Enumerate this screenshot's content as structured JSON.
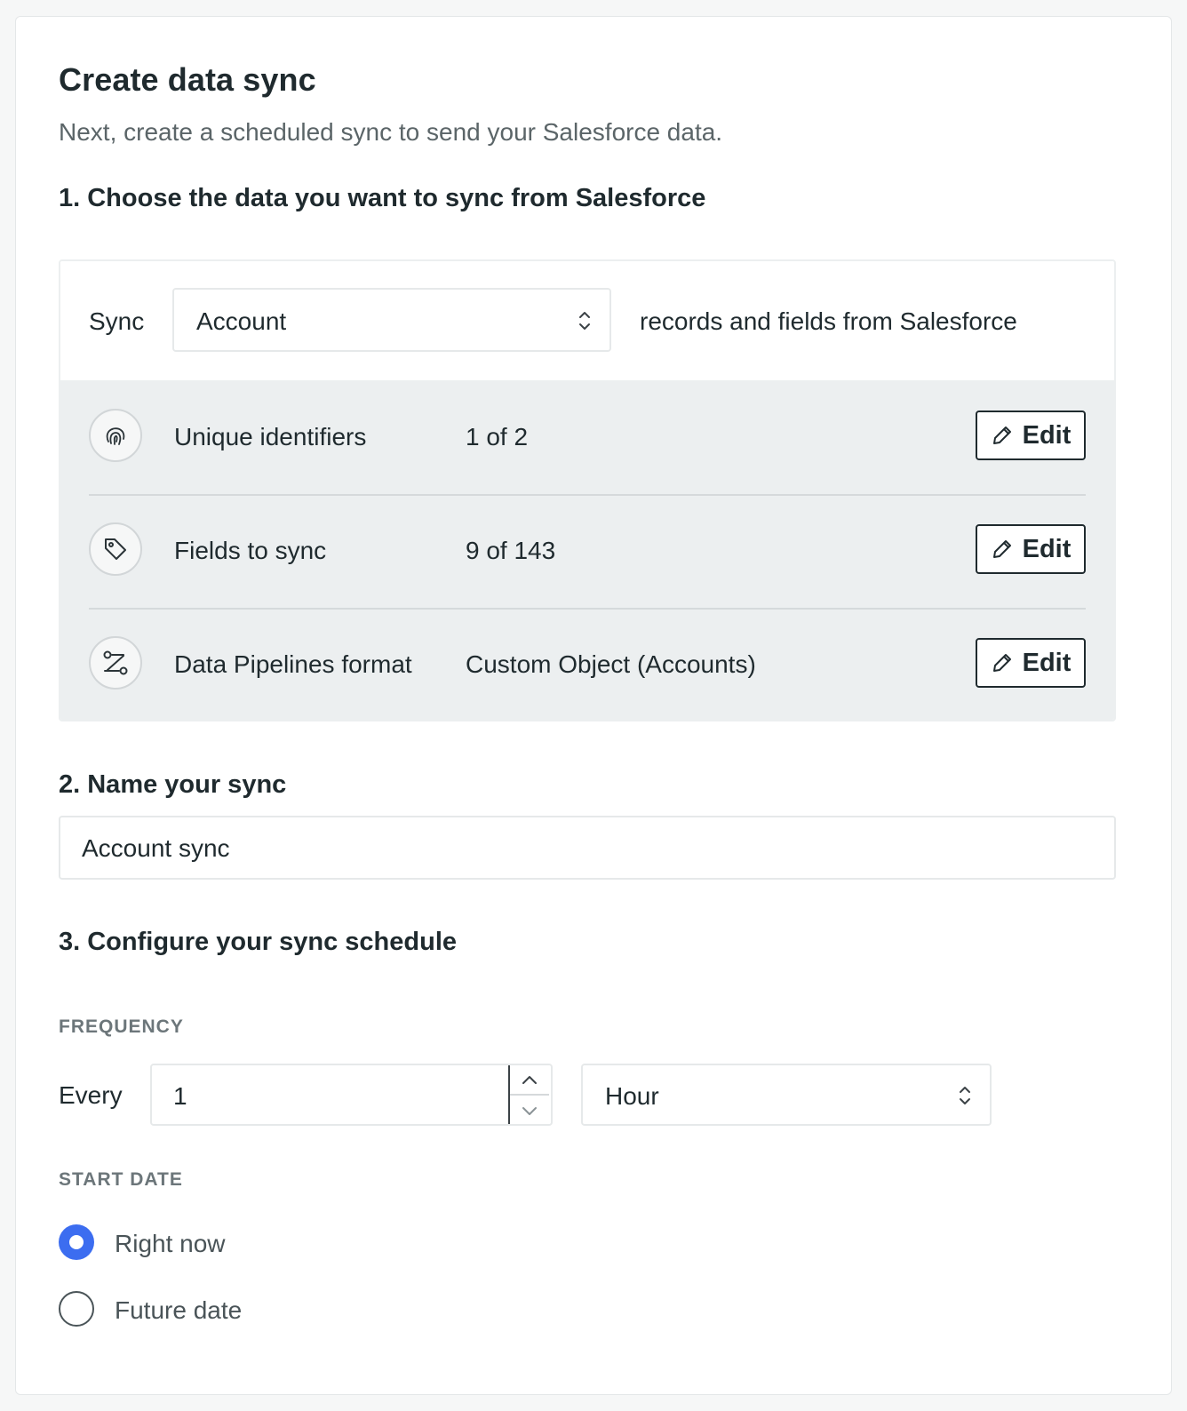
{
  "header": {
    "title": "Create data sync",
    "subtitle": "Next, create a scheduled sync to send your Salesforce data."
  },
  "step1": {
    "heading": "1. Choose the data you want to sync from Salesforce",
    "sync_prefix": "Sync",
    "object_select_value": "Account",
    "sync_suffix": "records and fields from Salesforce",
    "rows": [
      {
        "icon": "fingerprint-icon",
        "label": "Unique identifiers",
        "value": "1 of 2",
        "action": "Edit"
      },
      {
        "icon": "tag-icon",
        "label": "Fields to sync",
        "value": "9 of 143",
        "action": "Edit"
      },
      {
        "icon": "transform-icon",
        "label": "Data Pipelines format",
        "value": "Custom Object (Accounts)",
        "action": "Edit"
      }
    ]
  },
  "step2": {
    "heading": "2. Name your sync",
    "name_value": "Account sync"
  },
  "step3": {
    "heading": "3. Configure your sync schedule",
    "frequency_label": "FREQUENCY",
    "every_label": "Every",
    "interval_value": "1",
    "unit_value": "Hour",
    "start_date_label": "START DATE",
    "options": [
      {
        "label": "Right now",
        "selected": true
      },
      {
        "label": "Future date",
        "selected": false
      }
    ]
  },
  "colors": {
    "accent": "#3c6df0",
    "panel_bg": "#eceff0",
    "text": "#1f2a2e",
    "muted": "#5b6568"
  }
}
